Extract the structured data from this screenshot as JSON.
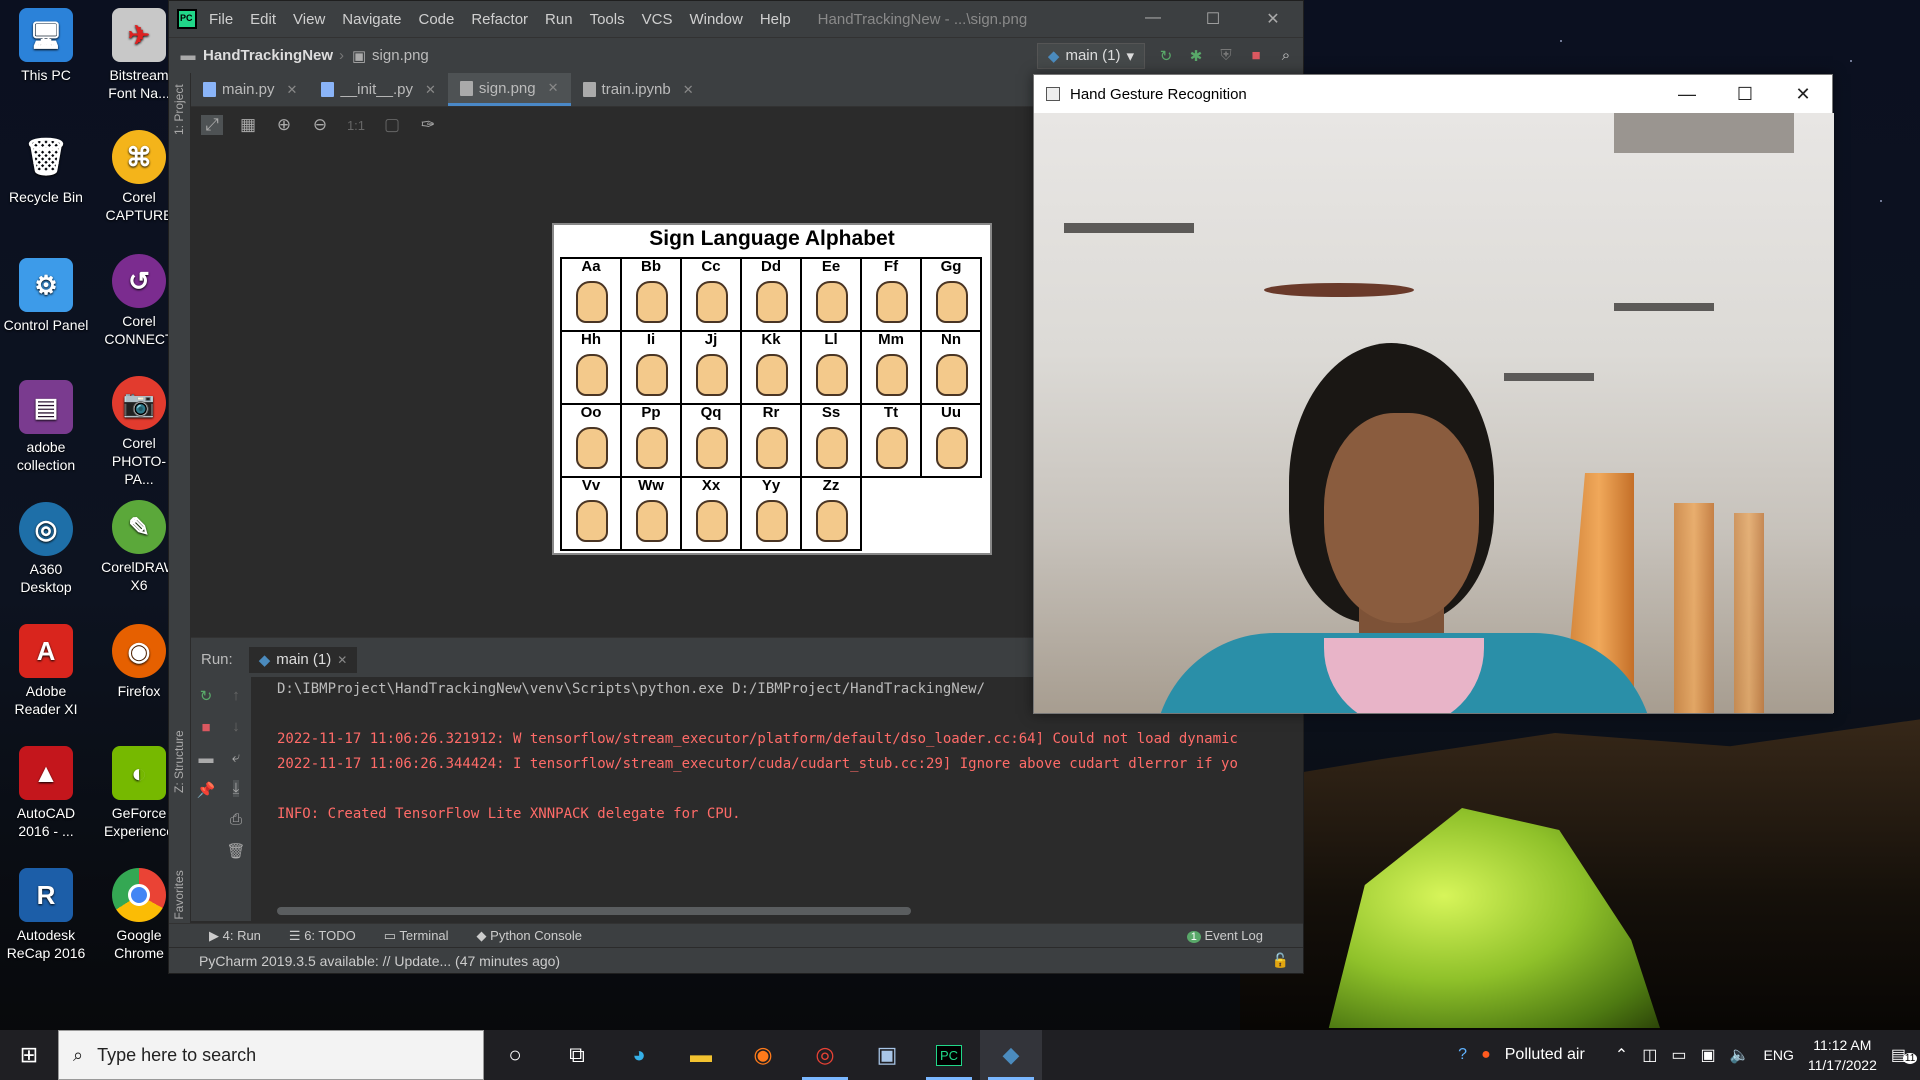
{
  "desktop": {
    "icons": [
      {
        "label": "This PC"
      },
      {
        "label": "Bitstream Font Na..."
      },
      {
        "label": "Recycle Bin"
      },
      {
        "label": "Corel CAPTURE"
      },
      {
        "label": "Control Panel"
      },
      {
        "label": "Corel CONNECT"
      },
      {
        "label": "adobe collection"
      },
      {
        "label": "Corel PHOTO-PA..."
      },
      {
        "label": "A360 Desktop"
      },
      {
        "label": "CorelDRAW X6"
      },
      {
        "label": "Adobe Reader XI"
      },
      {
        "label": "Firefox"
      },
      {
        "label": "AutoCAD 2016 - ..."
      },
      {
        "label": "GeForce Experience"
      },
      {
        "label": "Autodesk ReCap 2016"
      },
      {
        "label": "Google Chrome"
      }
    ]
  },
  "ide": {
    "menu": [
      "File",
      "Edit",
      "View",
      "Navigate",
      "Code",
      "Refactor",
      "Run",
      "Tools",
      "VCS",
      "Window",
      "Help"
    ],
    "window_title": "HandTrackingNew - ...\\sign.png",
    "breadcrumb": {
      "project": "HandTrackingNew",
      "file": "sign.png"
    },
    "run_config": "main (1)",
    "tabs": [
      {
        "label": "main.py"
      },
      {
        "label": "__init__.py"
      },
      {
        "label": "sign.png"
      },
      {
        "label": "train.ipynb"
      }
    ],
    "side_labels": {
      "project": "1: Project",
      "structure": "Z: Structure",
      "favorites": "2: Favorites"
    },
    "image_toolbar_zoom": "1:1",
    "image": {
      "title": "Sign Language Alphabet",
      "letters": [
        "Aa",
        "Bb",
        "Cc",
        "Dd",
        "Ee",
        "Ff",
        "Gg",
        "Hh",
        "Ii",
        "Jj",
        "Kk",
        "Ll",
        "Mm",
        "Nn",
        "Oo",
        "Pp",
        "Qq",
        "Rr",
        "Ss",
        "Tt",
        "Uu",
        "Vv",
        "Ww",
        "Xx",
        "Yy",
        "Zz"
      ]
    },
    "run": {
      "label": "Run:",
      "tab": "main (1)",
      "console": [
        "D:\\IBMProject\\HandTrackingNew\\venv\\Scripts\\python.exe D:/IBMProject/HandTrackingNew/",
        "",
        "2022-11-17 11:06:26.321912: W tensorflow/stream_executor/platform/default/dso_loader.cc:64] Could not load dynamic",
        "2022-11-17 11:06:26.344424: I tensorflow/stream_executor/cuda/cudart_stub.cc:29] Ignore above cudart dlerror if yo",
        "",
        "INFO: Created TensorFlow Lite XNNPACK delegate for CPU."
      ]
    },
    "bottom_tabs": {
      "run": "4: Run",
      "todo": "6: TODO",
      "terminal": "Terminal",
      "python_console": "Python Console",
      "event_log": "Event Log",
      "event_count": "1"
    },
    "status": "PyCharm 2019.3.5 available: // Update... (47 minutes ago)"
  },
  "gesture_window": {
    "title": "Hand Gesture Recognition"
  },
  "taskbar": {
    "search_placeholder": "Type here to search",
    "weather": "Polluted air",
    "language": "ENG",
    "time": "11:12 AM",
    "date": "11/17/2022",
    "notifications": "11"
  },
  "colors": {
    "ide_bg": "#2b2b2b",
    "error_text": "#ff6b68",
    "accent": "#4a88c7"
  }
}
